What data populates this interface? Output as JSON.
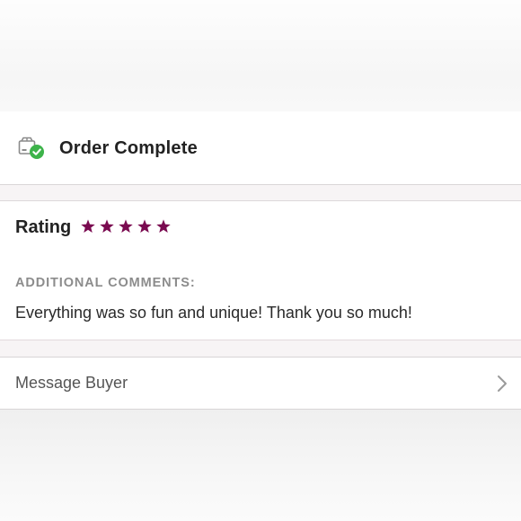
{
  "order": {
    "title": "Order Complete",
    "icon": "package-check-icon",
    "status_color": "#3db34a"
  },
  "rating": {
    "label": "Rating",
    "stars": 5,
    "max_stars": 5,
    "star_color": "#7a0a50"
  },
  "comments": {
    "label": "ADDITIONAL COMMENTS:",
    "text": "Everything was so fun and unique! Thank you so much!"
  },
  "message": {
    "label": "Message Buyer",
    "icon": "chevron-right-icon"
  }
}
